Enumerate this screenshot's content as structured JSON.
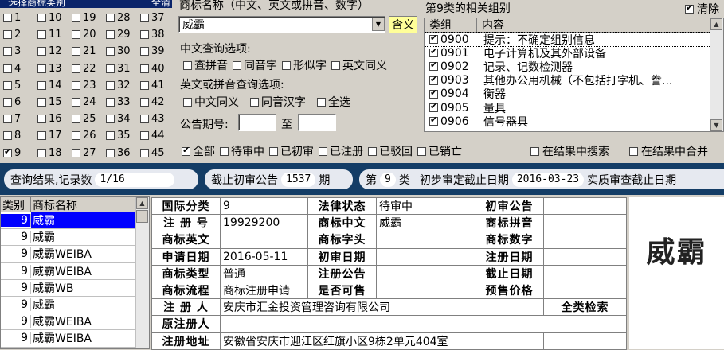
{
  "class_panel": {
    "title": "选择商标类别",
    "clear_label": "全清",
    "classes": [
      [
        {
          "n": "1",
          "c": false
        },
        {
          "n": "10",
          "c": false
        },
        {
          "n": "19",
          "c": false
        },
        {
          "n": "28",
          "c": false
        },
        {
          "n": "37",
          "c": false
        }
      ],
      [
        {
          "n": "2",
          "c": false
        },
        {
          "n": "11",
          "c": false
        },
        {
          "n": "20",
          "c": false
        },
        {
          "n": "29",
          "c": false
        },
        {
          "n": "38",
          "c": false
        }
      ],
      [
        {
          "n": "3",
          "c": false
        },
        {
          "n": "12",
          "c": false
        },
        {
          "n": "21",
          "c": false
        },
        {
          "n": "30",
          "c": false
        },
        {
          "n": "39",
          "c": false
        }
      ],
      [
        {
          "n": "4",
          "c": false
        },
        {
          "n": "13",
          "c": false
        },
        {
          "n": "22",
          "c": false
        },
        {
          "n": "31",
          "c": false
        },
        {
          "n": "40",
          "c": false
        }
      ],
      [
        {
          "n": "5",
          "c": false
        },
        {
          "n": "14",
          "c": false
        },
        {
          "n": "23",
          "c": false
        },
        {
          "n": "32",
          "c": false
        },
        {
          "n": "41",
          "c": false
        }
      ],
      [
        {
          "n": "6",
          "c": false
        },
        {
          "n": "15",
          "c": false
        },
        {
          "n": "24",
          "c": false
        },
        {
          "n": "33",
          "c": false
        },
        {
          "n": "42",
          "c": false
        }
      ],
      [
        {
          "n": "7",
          "c": false
        },
        {
          "n": "16",
          "c": false
        },
        {
          "n": "25",
          "c": false
        },
        {
          "n": "34",
          "c": false
        },
        {
          "n": "43",
          "c": false
        }
      ],
      [
        {
          "n": "8",
          "c": false
        },
        {
          "n": "17",
          "c": false
        },
        {
          "n": "26",
          "c": false
        },
        {
          "n": "35",
          "c": false
        },
        {
          "n": "44",
          "c": false
        }
      ],
      [
        {
          "n": "9",
          "c": true
        },
        {
          "n": "18",
          "c": false
        },
        {
          "n": "27",
          "c": false
        },
        {
          "n": "36",
          "c": false
        },
        {
          "n": "45",
          "c": false
        }
      ]
    ]
  },
  "search": {
    "name_label": "商标名称（中文、英文或拼音、数字）",
    "name_value": "威霸",
    "contains_button": "含义",
    "cn_options_label": "中文查询选项:",
    "cn_options": [
      "查拼音",
      "同音字",
      "形似字",
      "英文同义"
    ],
    "en_options_label": "英文或拼音查询选项:",
    "en_options": [
      "中文同义",
      "同音汉字",
      "全选"
    ],
    "period_label": "公告期号:",
    "period_to": "至"
  },
  "groups": {
    "title": "第9类的相关组别",
    "clear_label": "清除",
    "col_group": "类组",
    "col_content": "内容",
    "rows": [
      {
        "code": "0900",
        "text": "提示：不确定组别信息",
        "c": true,
        "sel": true
      },
      {
        "code": "0901",
        "text": "电子计算机及其外部设备",
        "c": true,
        "sel": false
      },
      {
        "code": "0902",
        "text": "记录、记数检测器",
        "c": true,
        "sel": false
      },
      {
        "code": "0903",
        "text": "其他办公用机械（不包括打字机、誊...",
        "c": true,
        "sel": false
      },
      {
        "code": "0904",
        "text": "衡器",
        "c": true,
        "sel": false
      },
      {
        "code": "0905",
        "text": "量具",
        "c": true,
        "sel": false
      },
      {
        "code": "0906",
        "text": "信号器具",
        "c": true,
        "sel": false
      }
    ]
  },
  "status_filters": {
    "items": [
      {
        "label": "全部",
        "c": true
      },
      {
        "label": "待审中",
        "c": false
      },
      {
        "label": "已初审",
        "c": false
      },
      {
        "label": "已注册",
        "c": false
      },
      {
        "label": "已驳回",
        "c": false
      },
      {
        "label": "已销亡",
        "c": false
      }
    ],
    "search_in_results": "在结果中搜索",
    "merge_in_results": "在结果中合并"
  },
  "status_bar": {
    "result_label": "查询结果,记录数",
    "result_value": "1/16",
    "cutoff_label": "截止初审公告",
    "cutoff_value": "1537",
    "cutoff_unit": "期",
    "class_prefix": "第",
    "class_value": "9",
    "class_suffix": "类",
    "initial_date_label": "初步审定截止日期",
    "initial_date_value": "2016-03-23",
    "substantive_label": "实质审查截止日期"
  },
  "results": {
    "col_class": "类别",
    "col_name": "商标名称",
    "rows": [
      {
        "cls": "9",
        "name": "威霸",
        "sel": true
      },
      {
        "cls": "9",
        "name": "威霸",
        "sel": false
      },
      {
        "cls": "9",
        "name": "威霸WEIBA",
        "sel": false
      },
      {
        "cls": "9",
        "name": "威霸WEIBA",
        "sel": false
      },
      {
        "cls": "9",
        "name": "威霸WB",
        "sel": false
      },
      {
        "cls": "9",
        "name": "威霸",
        "sel": false
      },
      {
        "cls": "9",
        "name": "威霸WEIBA",
        "sel": false
      },
      {
        "cls": "9",
        "name": "威霸WEIBA",
        "sel": false
      }
    ]
  },
  "detail": {
    "intl_class_label": "国际分类",
    "intl_class_value": "9",
    "legal_status_label": "法律状态",
    "legal_status_value": "待审中",
    "initial_pub_label": "初审公告",
    "reg_no_label": "注 册 号",
    "reg_no_value": "19929200",
    "mark_cn_label": "商标中文",
    "mark_cn_value": "威霸",
    "mark_pinyin_label": "商标拼音",
    "mark_en_label": "商标英文",
    "mark_initials_label": "商标字头",
    "mark_digits_label": "商标数字",
    "apply_date_label": "申请日期",
    "apply_date_value": "2016-05-11",
    "initial_date_label": "初审日期",
    "reg_date_label": "注册日期",
    "mark_type_label": "商标类型",
    "mark_type_value": "普通",
    "reg_pub_label": "注册公告",
    "expiry_label": "截止日期",
    "process_label": "商标流程",
    "process_value": "商标注册申请",
    "sellable_label": "是否可售",
    "presale_label": "预售价格",
    "registrant_label": "注 册 人",
    "registrant_value": "安庆市汇金投资管理咨询有限公司",
    "full_search_label": "全类检索",
    "orig_registrant_label": "原注册人",
    "address_label": "注册地址",
    "address_value": "安徽省安庆市迎江区红旗小区9栋2单元404室"
  },
  "preview": {
    "mark_text": "威霸"
  }
}
